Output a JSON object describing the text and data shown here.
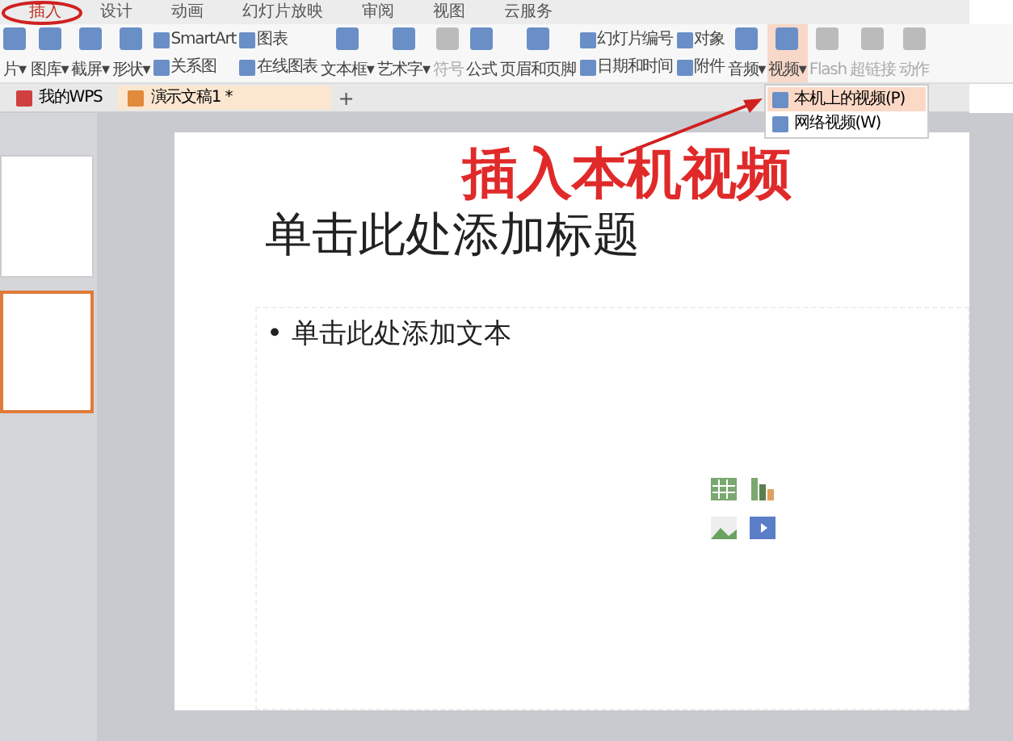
{
  "menu_tabs": [
    {
      "label": "插入",
      "selected": true
    },
    {
      "label": "设计",
      "selected": false
    },
    {
      "label": "动画",
      "selected": false
    },
    {
      "label": "幻灯片放映",
      "selected": false
    },
    {
      "label": "审阅",
      "selected": false
    },
    {
      "label": "视图",
      "selected": false
    },
    {
      "label": "云服务",
      "selected": false
    }
  ],
  "ribbon": [
    {
      "kind": "big",
      "label": "片▾",
      "disabled": false
    },
    {
      "kind": "big",
      "label": "图库▾",
      "disabled": false
    },
    {
      "kind": "big",
      "label": "截屏▾",
      "disabled": false
    },
    {
      "kind": "big",
      "label": "形状▾",
      "disabled": false
    },
    {
      "kind": "pair",
      "labels": [
        "SmartArt",
        "关系图"
      ],
      "disabled": false
    },
    {
      "kind": "pair",
      "labels": [
        "图表",
        "在线图表"
      ],
      "disabled": false
    },
    {
      "kind": "big",
      "label": "文本框▾",
      "disabled": false
    },
    {
      "kind": "big",
      "label": "艺术字▾",
      "disabled": false
    },
    {
      "kind": "big",
      "label": "符号",
      "disabled": true
    },
    {
      "kind": "big",
      "label": "公式",
      "disabled": false
    },
    {
      "kind": "big",
      "label": "页眉和页脚",
      "disabled": false
    },
    {
      "kind": "pair",
      "labels": [
        "幻灯片编号",
        "日期和时间"
      ],
      "disabled": false
    },
    {
      "kind": "pair",
      "labels": [
        "对象",
        "附件"
      ],
      "disabled": false
    },
    {
      "kind": "big",
      "label": "音频▾",
      "disabled": false
    },
    {
      "kind": "big",
      "label": "视频▾",
      "disabled": false,
      "menu": [
        {
          "label": "本机上的视频(P)",
          "selected": true
        },
        {
          "label": "网络视频(W)",
          "selected": false
        }
      ]
    },
    {
      "kind": "big",
      "label": "Flash",
      "disabled": true
    },
    {
      "kind": "big",
      "label": "超链接",
      "disabled": true
    },
    {
      "kind": "big",
      "label": "动作",
      "disabled": true
    }
  ],
  "doc_tabs": [
    {
      "label": "我的WPS",
      "selected": false
    },
    {
      "label": "演示文稿1 *",
      "selected": true
    }
  ],
  "new_tab": "+",
  "slides": [
    {
      "selected": false
    },
    {
      "selected": true
    }
  ],
  "slide": {
    "title_placeholder": "单击此处添加标题",
    "body_placeholder": "单击此处添加文本",
    "bullet": "•"
  },
  "annotation": "插入本机视频"
}
